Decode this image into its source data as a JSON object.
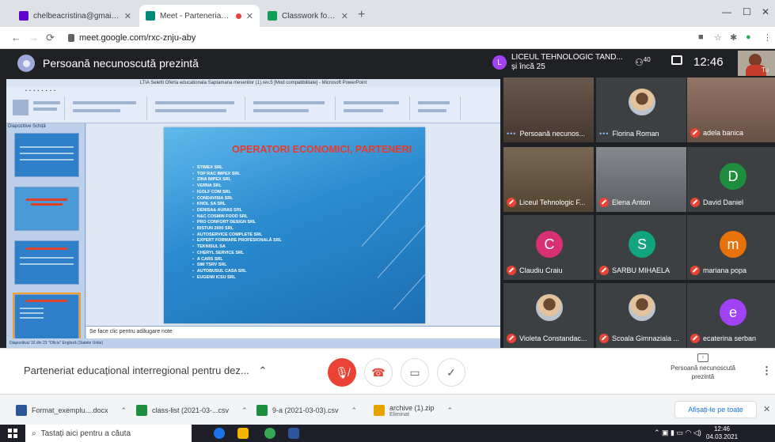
{
  "browser": {
    "tabs": [
      {
        "title": "chelbeacristina@gmail.com - Yah",
        "favicon_color": "#6001d2",
        "active": false
      },
      {
        "title": "Meet - Parteneriat educational",
        "favicon_color": "#00897b",
        "active": true
      },
      {
        "title": "Classwork for XI D T.I.A. - M L M",
        "favicon_color": "#0f9d58",
        "active": false
      }
    ],
    "url": "meet.google.com/rxc-znju-aby"
  },
  "meet": {
    "presenter_banner": "Persoană necunoscută prezintă",
    "org_name": "LICEUL TEHNOLOGIC TAND...",
    "org_sub": "și încă 25",
    "org_initial": "L",
    "participant_count": "40",
    "time": "12:46",
    "self_label": "Tu",
    "meeting_title": "Parteneriat educațional interregional pentru dez...",
    "presenting_label": "Persoană necunoscută prezintă",
    "participants": [
      {
        "name": "Persoană necunos...",
        "type": "video",
        "muted": false
      },
      {
        "name": "Florina Roman",
        "type": "photo",
        "muted": false
      },
      {
        "name": "adela banica",
        "type": "video",
        "muted": true
      },
      {
        "name": "Liceul Tehnologic F...",
        "type": "video",
        "muted": true
      },
      {
        "name": "Elena Anton",
        "type": "video",
        "muted": true
      },
      {
        "name": "David Daniel",
        "type": "letter",
        "initial": "D",
        "color": "#1e8e3e",
        "muted": true
      },
      {
        "name": "Claudiu Craiu",
        "type": "letter",
        "initial": "C",
        "color": "#d93074",
        "muted": true
      },
      {
        "name": "SARBU MIHAELA",
        "type": "letter",
        "initial": "S",
        "color": "#12a37f",
        "muted": true
      },
      {
        "name": "mariana popa",
        "type": "letter",
        "initial": "m",
        "color": "#e8710a",
        "muted": true
      },
      {
        "name": "Violeta Constandac...",
        "type": "photo",
        "muted": true
      },
      {
        "name": "Scoala Gimnaziala ...",
        "type": "photo",
        "muted": true
      },
      {
        "name": "ecaterina serban",
        "type": "letter",
        "initial": "e",
        "color": "#a142f4",
        "muted": true
      }
    ]
  },
  "presentation": {
    "window_title": "LTIA Seletti Oferta educationala   Saptamana meseriilor (1).rev.5 [Mod compatibilitate] - Microsoft PowerPoint",
    "left_tab": "Diapozitive   Schiță",
    "slide_title": "OPERATORI  ECONOMICI, PARTENERI",
    "partners": [
      "STIMEX SRL",
      "TOP RAC IMPEX SRL",
      "ZINA IMPEX SRL",
      "VERNA SRL",
      "IGOLF COM SRL",
      "CONDAVISIA SRL",
      "KNOL SA SRL",
      "DENISA& AURAS SRL",
      "N&C COSMIN FOOD SRL",
      "PRO CONFORT DESIGN SRL",
      "BISTUN 2000 SRL",
      "AUTOSERVICE COMPLETE SRL",
      "EXPERT FORMARE PROFESIONALĂ SRL",
      "TEKNISUL SA",
      "CHERYL SERVICE SRL",
      "A CARS SRL",
      "SIM TSRV SRL",
      "AUTOBUSUL CASA SRL",
      "EUGENII ICSU SRL"
    ],
    "notes_placeholder": "Se face clic pentru adăugare note",
    "status": "Diapozitivul 16 din 23   \"Oficiu\"   Engleză (Statele Unite)"
  },
  "downloads": {
    "items": [
      {
        "name": "Format_exemplu....docx",
        "sub": "",
        "color": "#2b579a"
      },
      {
        "name": "class-list (2021-03-...csv",
        "sub": "",
        "color": "#1e8e3e"
      },
      {
        "name": "9-a (2021-03-03).csv",
        "sub": "",
        "color": "#1e8e3e"
      },
      {
        "name": "archive (1).zip",
        "sub": "Eliminat",
        "color": "#e8a200"
      }
    ],
    "show_all": "Afișați-le pe toate"
  },
  "taskbar": {
    "search_placeholder": "Tastați aici pentru a căuta",
    "time": "12:46",
    "date": "04.03.2021"
  },
  "icons": [
    "mail-icon",
    "meet-icon",
    "classroom-icon",
    "lock-icon",
    "mic-off-icon",
    "end-call-icon",
    "camera-icon",
    "raise-hand-icon",
    "people-icon",
    "chat-icon",
    "windows-icon",
    "search-icon"
  ]
}
